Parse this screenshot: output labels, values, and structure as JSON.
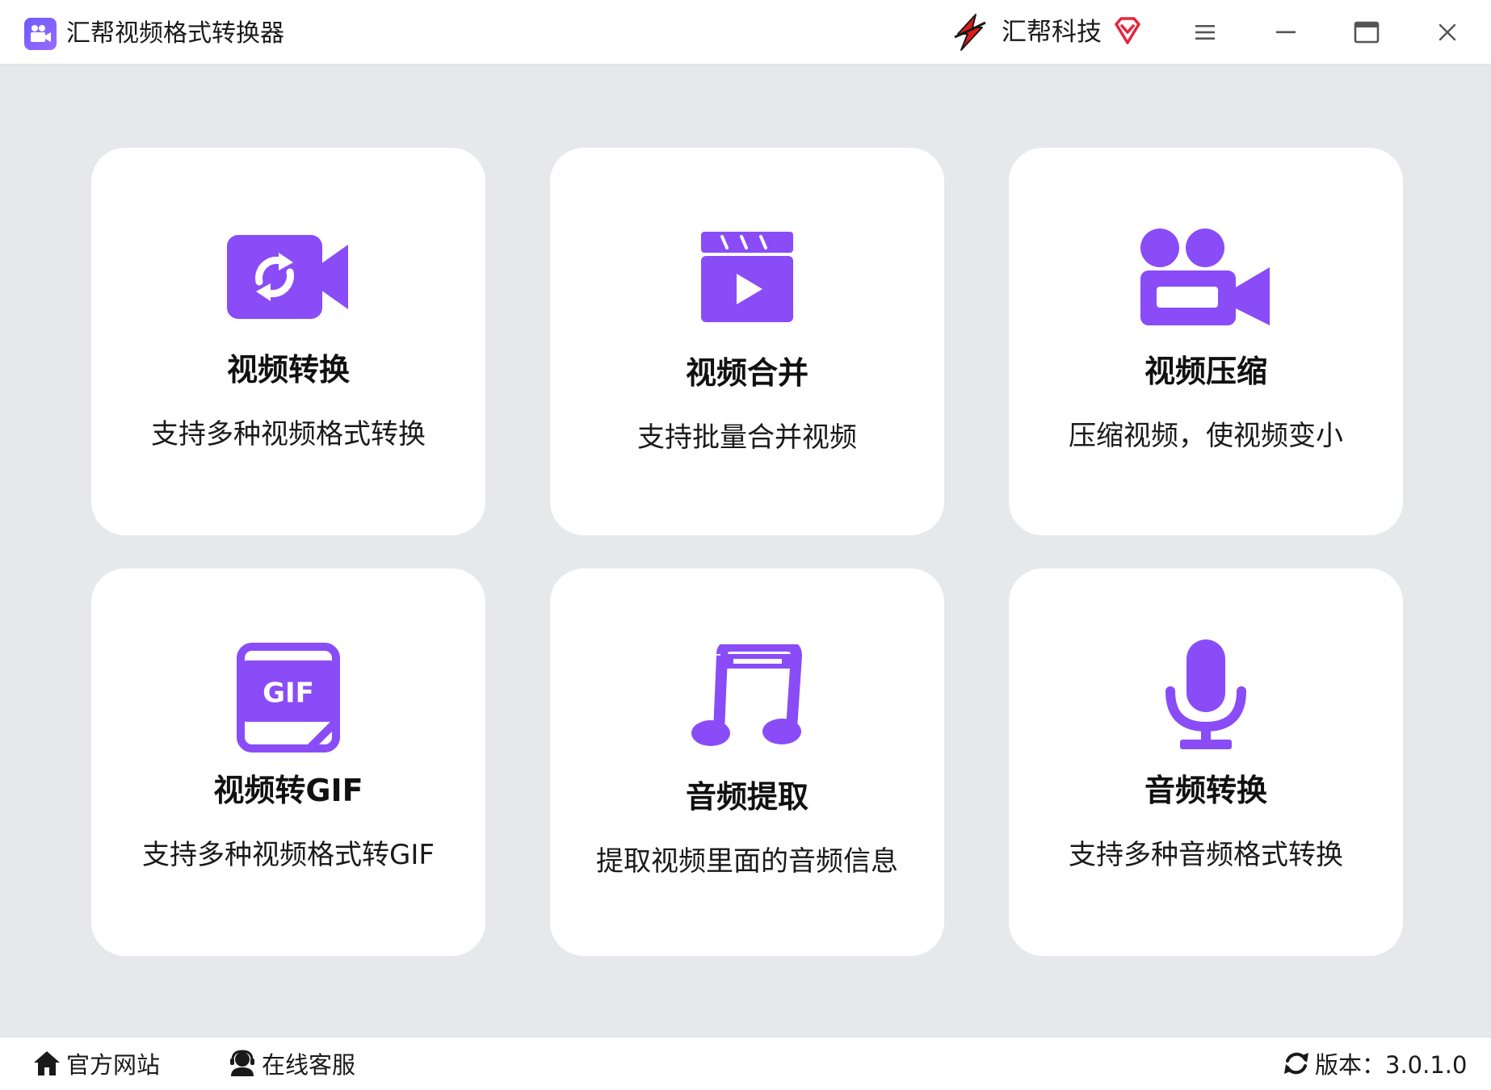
{
  "window": {
    "title": "汇帮视频格式转换器",
    "brand": "汇帮科技",
    "icons": {
      "app": "video-camera-icon",
      "brand": "huibang-logo-icon",
      "vip": "vip-diamond-icon",
      "menu": "hamburger-menu-icon",
      "minimize": "minimize-icon",
      "maximize": "maximize-icon",
      "close": "close-icon"
    }
  },
  "accent_color": "#8a4cf7",
  "features": [
    {
      "title": "视频转换",
      "desc": "支持多种视频格式转换",
      "icon": "video-convert-icon"
    },
    {
      "title": "视频合并",
      "desc": "支持批量合并视频",
      "icon": "clapperboard-play-icon"
    },
    {
      "title": "视频压缩",
      "desc": "压缩视频，使视频变小",
      "icon": "movie-camera-icon"
    },
    {
      "title": "视频转GIF",
      "desc": "支持多种视频格式转GIF",
      "icon": "gif-file-icon"
    },
    {
      "title": "音频提取",
      "desc": "提取视频里面的音频信息",
      "icon": "music-note-icon"
    },
    {
      "title": "音频转换",
      "desc": "支持多种音频格式转换",
      "icon": "microphone-icon"
    }
  ],
  "footer": {
    "website": "官方网站",
    "service": "在线客服",
    "version": "版本：3.0.1.0",
    "icons": {
      "website": "home-icon",
      "service": "headset-user-icon",
      "version": "refresh-icon"
    }
  }
}
